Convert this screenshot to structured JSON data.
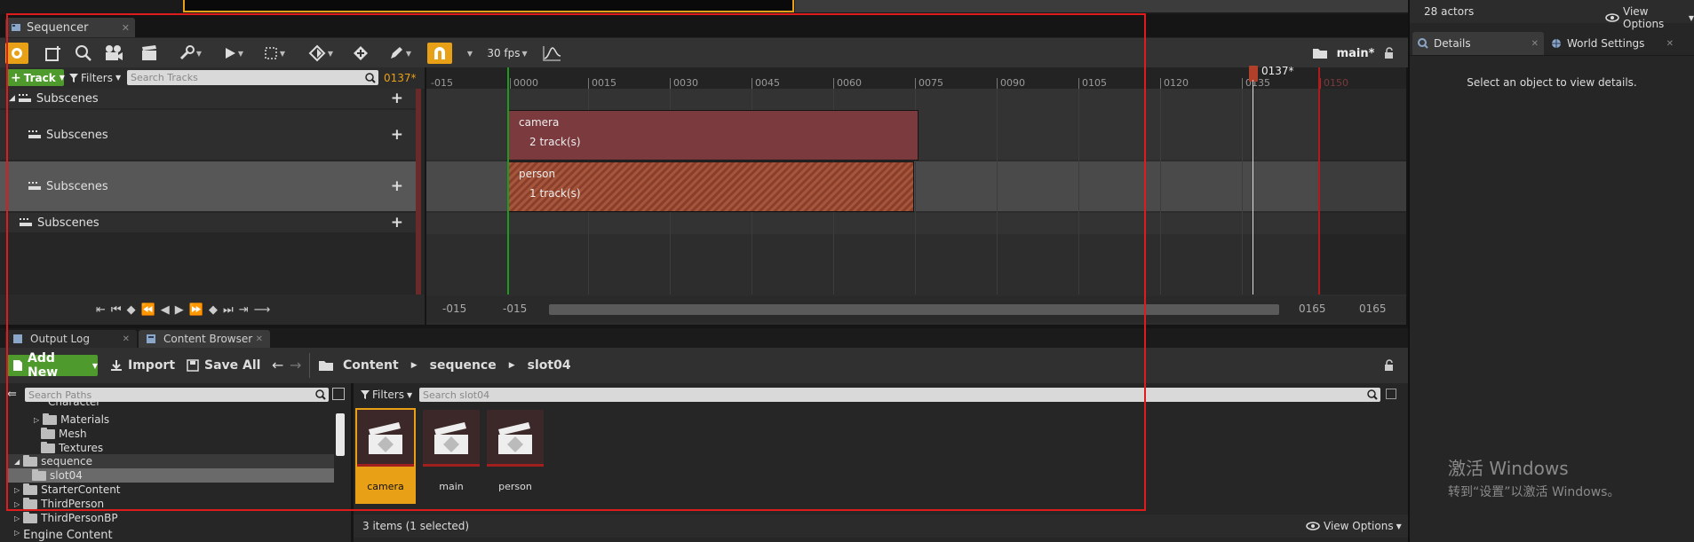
{
  "sequencer": {
    "tab_title": "Sequencer",
    "fps": "30 fps",
    "sequence_name": "main*",
    "add_track_label": "Track",
    "filters_label": "Filters",
    "search_placeholder": "Search Tracks",
    "current_frame": "0137*",
    "playhead_label": "0137*",
    "ruler_ticks": [
      "-015",
      "0000",
      "0015",
      "0030",
      "0045",
      "0060",
      "0075",
      "0090",
      "0105",
      "0120",
      "0135",
      "0150"
    ],
    "tracks": [
      {
        "label": "Subscenes"
      },
      {
        "label": "Subscenes"
      },
      {
        "label": "Subscenes"
      },
      {
        "label": "Subscenes"
      }
    ],
    "sections": [
      {
        "name": "camera",
        "count": "2 track(s)"
      },
      {
        "name": "person",
        "count": "1 track(s)"
      }
    ],
    "range": {
      "start_outer": "-015",
      "start_inner": "-015",
      "end_inner": "0165",
      "end_outer": "0165"
    }
  },
  "bottom_tabs": [
    {
      "label": "Output Log"
    },
    {
      "label": "Content Browser"
    }
  ],
  "content_browser": {
    "add_new": "Add New",
    "import": "Import",
    "save_all": "Save All",
    "breadcrumb": [
      "Content",
      "sequence",
      "slot04"
    ],
    "search_paths_placeholder": "Search Paths",
    "filters_label": "Filters",
    "search_assets_placeholder": "Search slot04",
    "tree": [
      {
        "label": "Character"
      },
      {
        "label": "Materials"
      },
      {
        "label": "Mesh"
      },
      {
        "label": "Textures"
      },
      {
        "label": "sequence"
      },
      {
        "label": "slot04"
      },
      {
        "label": "StarterContent"
      },
      {
        "label": "ThirdPerson"
      },
      {
        "label": "ThirdPersonBP"
      },
      {
        "label": "Engine Content"
      }
    ],
    "assets": [
      {
        "name": "camera",
        "selected": true
      },
      {
        "name": "main",
        "selected": false
      },
      {
        "name": "person",
        "selected": false
      }
    ],
    "status": "3 items (1 selected)",
    "view_options": "View Options"
  },
  "right_panel": {
    "actor_count": "28 actors",
    "view_options": "View Options",
    "tabs": [
      {
        "label": "Details"
      },
      {
        "label": "World Settings"
      }
    ],
    "empty_message": "Select an object to view details."
  },
  "watermark": {
    "line1": "激活 Windows",
    "line2": "转到“设置”以激活 Windows。"
  },
  "colors": {
    "accent_orange": "#e8a016",
    "add_green": "#4e9a2c",
    "section_red": "#7a3a3e",
    "section_hatch": "#a5563d",
    "annotation_red": "#e01b1b",
    "playhead": "#b0402a"
  }
}
